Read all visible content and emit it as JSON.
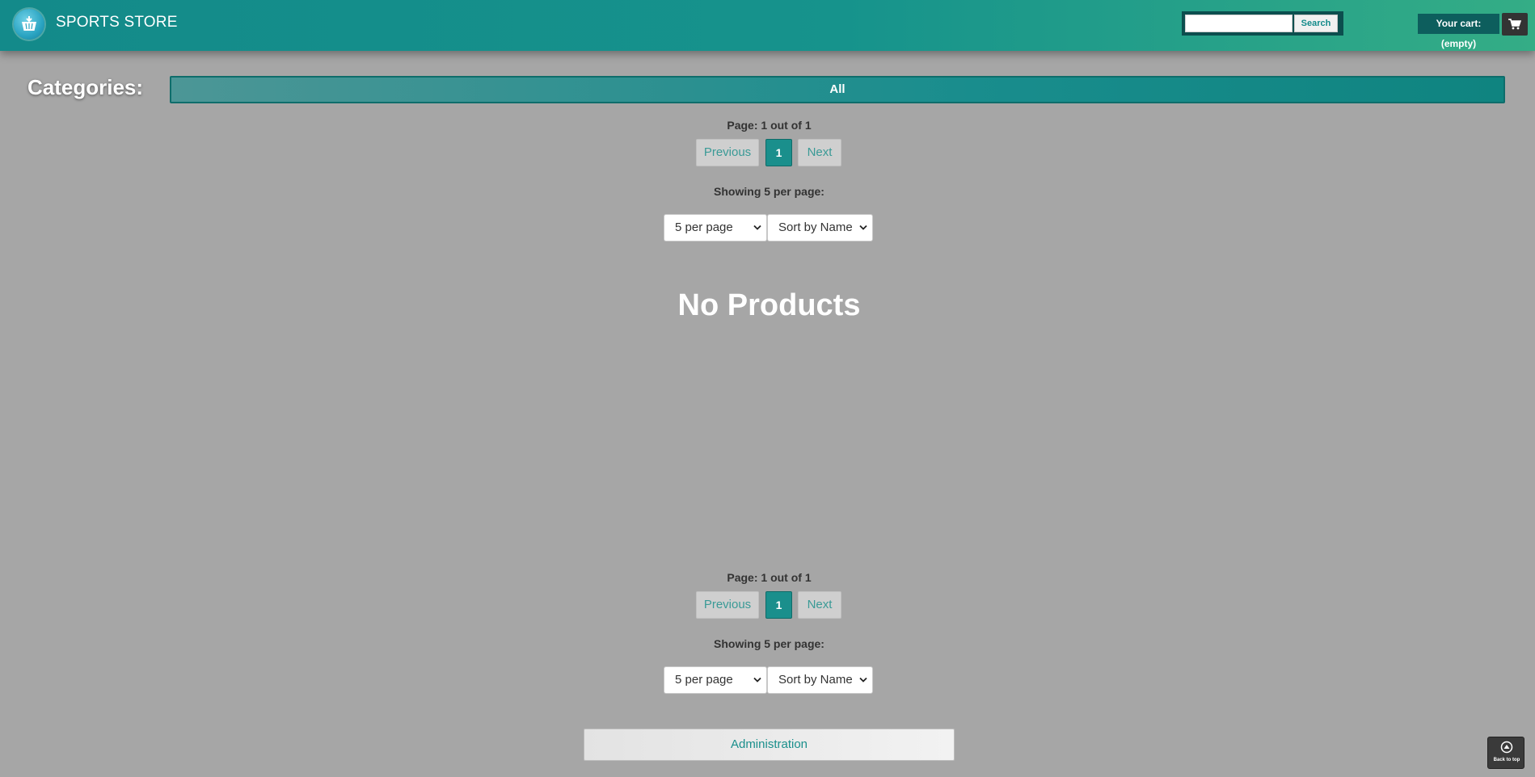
{
  "header": {
    "brand": "SPORTS STORE",
    "search_placeholder": "",
    "search_button": "Search",
    "cart_label": "Your cart: (empty)"
  },
  "categories": {
    "label": "Categories:",
    "items": [
      "All"
    ]
  },
  "pagination_top": {
    "page_info": "Page: 1 out of 1",
    "previous": "Previous",
    "current": "1",
    "next": "Next",
    "showing": "Showing 5 per page:",
    "per_page_selected": "5 per page",
    "sort_selected": "Sort by Name"
  },
  "main": {
    "empty_message": "No Products"
  },
  "pagination_bottom": {
    "page_info": "Page: 1 out of 1",
    "previous": "Previous",
    "current": "1",
    "next": "Next",
    "showing": "Showing 5 per page:",
    "per_page_selected": "5 per page",
    "sort_selected": "Sort by Name"
  },
  "footer": {
    "admin_button": "Administration",
    "back_to_top": "Back to top"
  },
  "colors": {
    "accent": "#1a8f8c",
    "page_background": "#a6a6a6"
  },
  "icons": [
    "basket-logo-icon",
    "cart-icon",
    "chevron-down-icon",
    "back-to-top-icon"
  ]
}
